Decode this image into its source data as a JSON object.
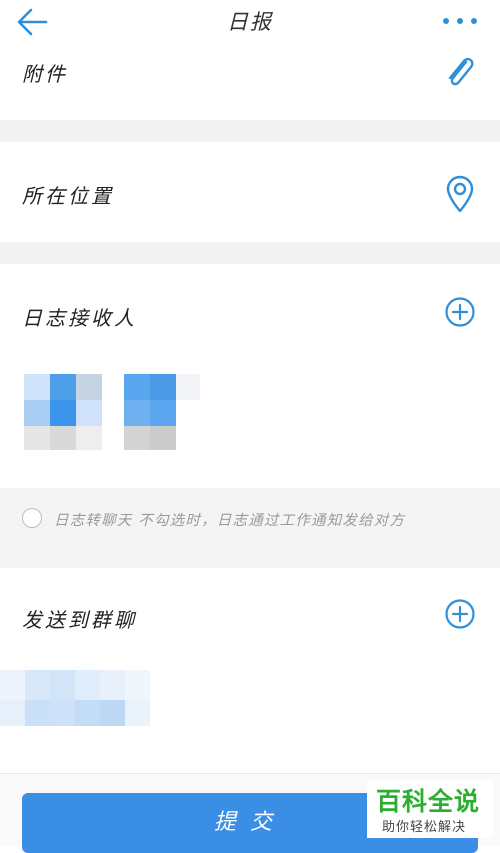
{
  "header": {
    "title": "日报",
    "back_icon": "arrow-left-icon",
    "more_icon": "more-dots-icon"
  },
  "rows": {
    "attachment": {
      "label": "附件",
      "icon": "paperclip-icon"
    },
    "location": {
      "label": "所在位置",
      "icon": "location-pin-icon"
    },
    "receivers": {
      "label": "日志接收人",
      "icon": "add-circle-icon"
    },
    "group_chat": {
      "label": "发送到群聊",
      "icon": "add-circle-icon"
    }
  },
  "notice": {
    "text": "日志转聊天 不勾选时，日志通过工作通知发给对方",
    "checked": false
  },
  "submit": {
    "label": "提交"
  },
  "watermark": {
    "main": "百科全说",
    "sub": "助你轻松解决"
  },
  "colors": {
    "accent": "#3a8ee6",
    "icon_blue": "#2f8fd8",
    "watermark_green": "#2cae31"
  }
}
